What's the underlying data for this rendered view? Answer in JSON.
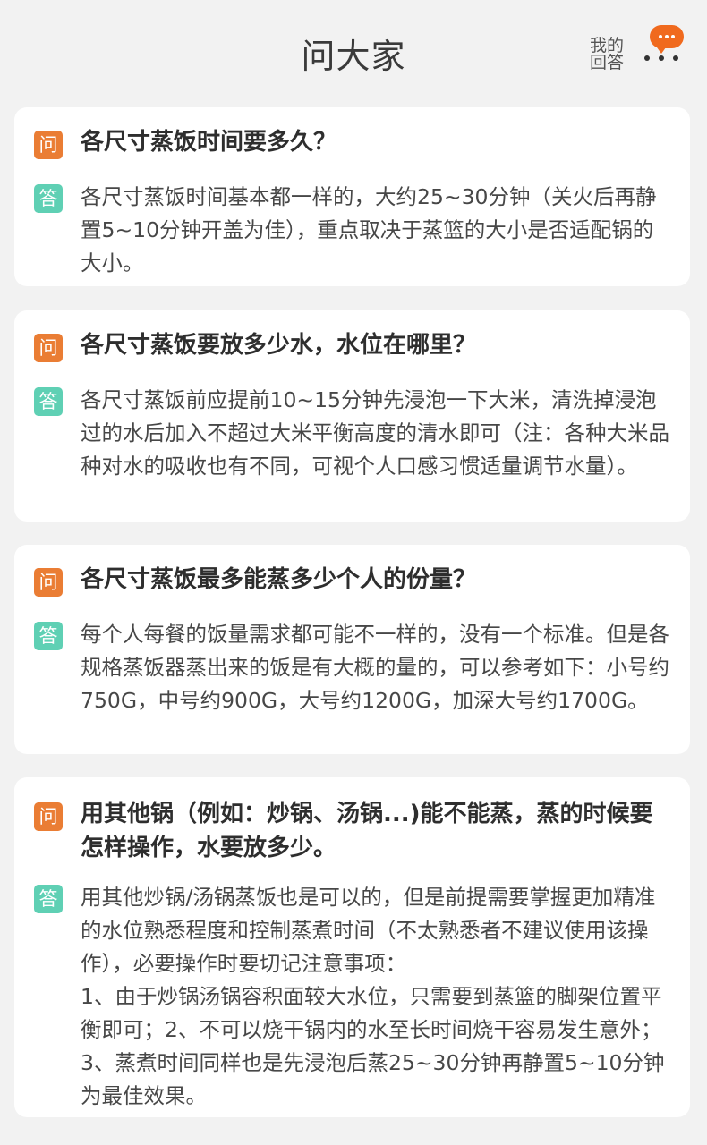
{
  "header": {
    "title": "问大家",
    "my_answers_label": "我的回答",
    "more_icon": "more-icon",
    "accent_color": "#f06a1e"
  },
  "badges": {
    "question": "问",
    "answer": "答",
    "question_color": "#ea7d34",
    "answer_color": "#5fd0b4"
  },
  "qa_items": [
    {
      "question": "各尺寸蒸饭时间要多久？",
      "answer": "各尺寸蒸饭时间基本都一样的，大约25~30分钟（关火后再静置5~10分钟开盖为佳），重点取决于蒸篮的大小是否适配锅的大小。"
    },
    {
      "question": "各尺寸蒸饭要放多少水，水位在哪里？",
      "answer": "各尺寸蒸饭前应提前10~15分钟先浸泡一下大米，清洗掉浸泡过的水后加入不超过大米平衡高度的清水即可（注：各种大米品种对水的吸收也有不同，可视个人口感习惯适量调节水量）。"
    },
    {
      "question": "各尺寸蒸饭最多能蒸多少个人的份量？",
      "answer": "每个人每餐的饭量需求都可能不一样的，没有一个标准。但是各规格蒸饭器蒸出来的饭是有大概的量的，可以参考如下：小号约750G，中号约900G，大号约1200G，加深大号约1700G。"
    },
    {
      "question": "用其他锅（例如：炒锅、汤锅...)能不能蒸，蒸的时候要怎样操作，水要放多少。",
      "answer": "用其他炒锅/汤锅蒸饭也是可以的，但是前提需要掌握更加精准的水位熟悉程度和控制蒸煮时间（不太熟悉者不建议使用该操作），必要操作时要切记注意事项：\n1、由于炒锅汤锅容积面较大水位，只需要到蒸篮的脚架位置平衡即可；2、不可以烧干锅内的水至长时间烧干容易发生意外；3、蒸煮时间同样也是先浸泡后蒸25~30分钟再静置5~10分钟为最佳效果。"
    }
  ]
}
